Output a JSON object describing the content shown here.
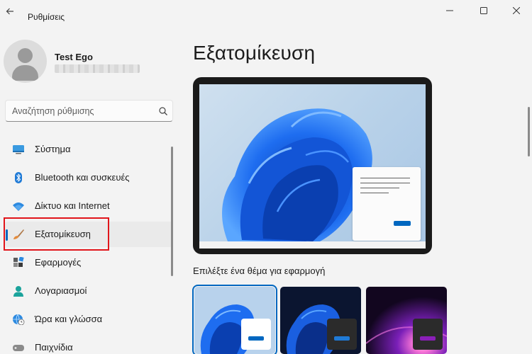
{
  "window": {
    "title": "Ρυθμίσεις",
    "back_icon": "arrow-left-icon",
    "controls": [
      "minimize-icon",
      "maximize-icon",
      "close-icon"
    ]
  },
  "profile": {
    "name": "Test Ego",
    "email_redacted": true
  },
  "search": {
    "placeholder": "Αναζήτηση ρύθμισης",
    "icon": "search-icon"
  },
  "sidebar": {
    "selected_index": 3,
    "items": [
      {
        "label": "Σύστημα",
        "icon": "monitor-icon"
      },
      {
        "label": "Bluetooth και συσκευές",
        "icon": "bluetooth-icon"
      },
      {
        "label": "Δίκτυο και Internet",
        "icon": "wifi-icon"
      },
      {
        "label": "Εξατομίκευση",
        "icon": "paintbrush-icon"
      },
      {
        "label": "Εφαρμογές",
        "icon": "apps-icon"
      },
      {
        "label": "Λογαριασμοί",
        "icon": "person-icon"
      },
      {
        "label": "Ώρα και γλώσσα",
        "icon": "globe-clock-icon"
      },
      {
        "label": "Παιχνίδια",
        "icon": "gamepad-icon"
      }
    ]
  },
  "main": {
    "title": "Εξατομίκευση",
    "theme_section_label": "Επιλέξτε ένα θέμα για εφαρμογή",
    "themes": [
      {
        "name": "windows-light-theme",
        "selected": true
      },
      {
        "name": "windows-dark-theme",
        "selected": false
      },
      {
        "name": "glow-theme",
        "selected": false
      }
    ]
  },
  "colors": {
    "accent": "#0067c0",
    "highlight_annotation": "#e1151a",
    "background": "#f3f3f3"
  }
}
